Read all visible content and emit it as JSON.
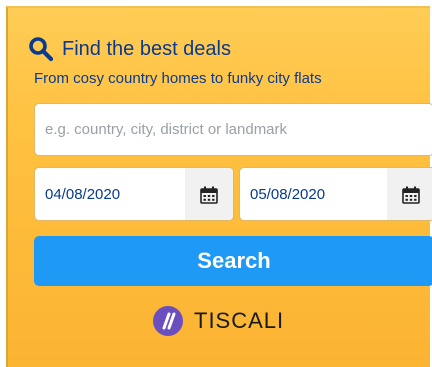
{
  "header": {
    "title": "Find the best deals",
    "subtitle": "From cosy country homes to funky city flats",
    "icon": "search-icon"
  },
  "destination": {
    "placeholder": "e.g. country, city, district or landmark",
    "value": ""
  },
  "dates": {
    "checkin": "04/08/2020",
    "checkout": "05/08/2020",
    "icon": "calendar-icon"
  },
  "search_button": {
    "label": "Search"
  },
  "brand": {
    "name": "TISCALI",
    "icon": "tiscali-logo-icon"
  },
  "colors": {
    "panel": "#ffc140",
    "text": "#0a3a8e",
    "button": "#1e99f5",
    "brand_mark": "#6b4fbe"
  }
}
